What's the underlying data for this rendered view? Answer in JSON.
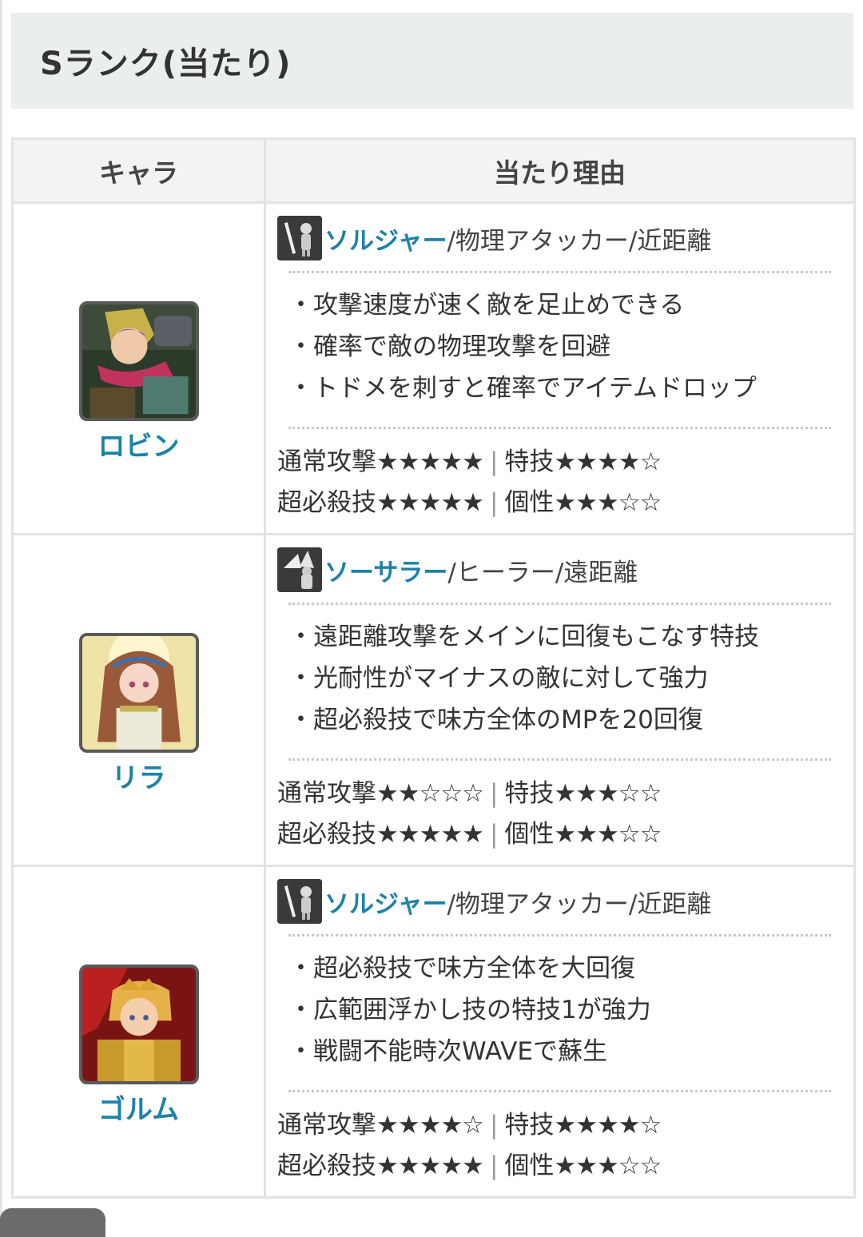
{
  "section_title": "Sランク(当たり)",
  "table": {
    "col_character": "キャラ",
    "col_reason": "当たり理由"
  },
  "rows": [
    {
      "name": "ロビン",
      "portrait": "portrait-robin",
      "role_icon": "soldier-icon",
      "role_class": "ソルジャー",
      "role_rest": "/物理アタッカー/近距離",
      "reasons": [
        "攻撃速度が速く敵を足止めできる",
        "確率で敵の物理攻撃を回避",
        "トドメを刺すと確率でアイテムドロップ"
      ],
      "normal_label": "通常攻撃",
      "normal_stars": "★★★★★",
      "skill_label": "特技",
      "skill_stars": "★★★★☆",
      "special_label": "超必殺技",
      "special_stars": "★★★★★",
      "trait_label": "個性",
      "trait_stars": "★★★☆☆"
    },
    {
      "name": "リラ",
      "portrait": "portrait-lila",
      "role_icon": "sorcerer-icon",
      "role_class": "ソーサラー",
      "role_rest": "/ヒーラー/遠距離",
      "reasons": [
        "遠距離攻撃をメインに回復もこなす特技",
        "光耐性がマイナスの敵に対して強力",
        "超必殺技で味方全体のMPを20回復"
      ],
      "normal_label": "通常攻撃",
      "normal_stars": "★★☆☆☆",
      "skill_label": "特技",
      "skill_stars": "★★★☆☆",
      "special_label": "超必殺技",
      "special_stars": "★★★★★",
      "trait_label": "個性",
      "trait_stars": "★★★☆☆"
    },
    {
      "name": "ゴルム",
      "portrait": "portrait-golm",
      "role_icon": "soldier-icon",
      "role_class": "ソルジャー",
      "role_rest": "/物理アタッカー/近距離",
      "reasons": [
        "超必殺技で味方全体を大回復",
        "広範囲浮かし技の特技1が強力",
        "戦闘不能時次WAVEで蘇生"
      ],
      "normal_label": "通常攻撃",
      "normal_stars": "★★★★☆",
      "skill_label": "特技",
      "skill_stars": "★★★★☆",
      "special_label": "超必殺技",
      "special_stars": "★★★★★",
      "trait_label": "個性",
      "trait_stars": "★★★☆☆"
    }
  ],
  "colors": {
    "link": "#1e82a6",
    "heading_bg": "#ebeeee",
    "border": "#e1e4e4"
  }
}
